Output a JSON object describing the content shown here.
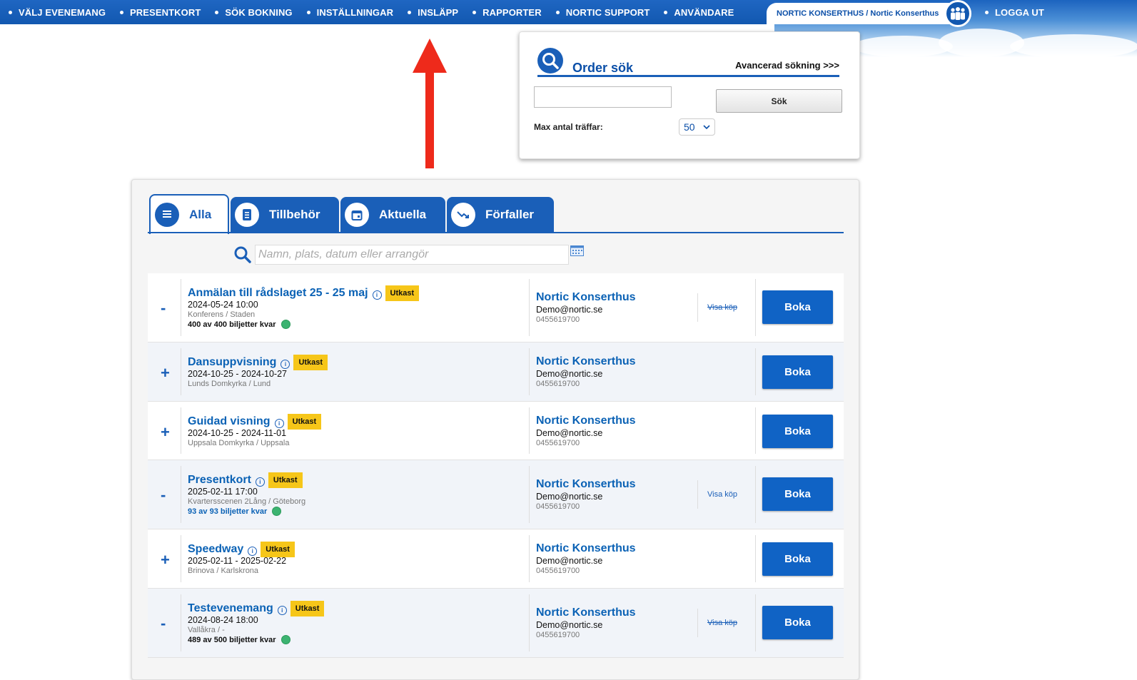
{
  "nav": {
    "items": [
      "VÄLJ EVENEMANG",
      "PRESENTKORT",
      "SÖK BOKNING",
      "INSTÄLLNINGAR",
      "INSLÄPP",
      "RAPPORTER",
      "NORTIC SUPPORT",
      "ANVÄNDARE"
    ],
    "org": "NORTIC KONSERTHUS / Nortic Konserthus",
    "logout": "LOGGA UT",
    "org_icon": "users-icon"
  },
  "order_search": {
    "title": "Order sök",
    "advanced": "Avancerad sökning >>>",
    "input_value": "",
    "button": "Sök",
    "max_label": "Max antal träffar:",
    "max_value": "50"
  },
  "tabs": [
    {
      "label": "Alla",
      "icon": "list-icon",
      "active": true
    },
    {
      "label": "Tillbehör",
      "icon": "document-icon",
      "active": false
    },
    {
      "label": "Aktuella",
      "icon": "calendar-icon",
      "active": false
    },
    {
      "label": "Förfaller",
      "icon": "trend-down-icon",
      "active": false
    }
  ],
  "search": {
    "placeholder": "Namn, plats, datum eller arrangör"
  },
  "events": [
    {
      "toggle": "-",
      "title": "Anmälan till rådslaget 25 - 25 maj",
      "badge": "Utkast",
      "date": "2024-05-24 10:00",
      "place": "Konferens / Staden",
      "left": "400 av 400 biljetter kvar",
      "org": "Nortic Konserthus",
      "email": "Demo@nortic.se",
      "phone": "0455619700",
      "visa": "Visa köp",
      "boka": "Boka"
    },
    {
      "toggle": "+",
      "title": "Dansuppvisning",
      "badge": "Utkast",
      "date": "2024-10-25 - 2024-10-27",
      "place": "Lunds Domkyrka / Lund",
      "left": "",
      "org": "Nortic Konserthus",
      "email": "Demo@nortic.se",
      "phone": "0455619700",
      "visa": "",
      "boka": "Boka"
    },
    {
      "toggle": "+",
      "title": "Guidad visning",
      "badge": "Utkast",
      "date": "2024-10-25 - 2024-11-01",
      "place": "Uppsala Domkyrka / Uppsala",
      "left": "",
      "org": "Nortic Konserthus",
      "email": "Demo@nortic.se",
      "phone": "0455619700",
      "visa": "",
      "boka": "Boka"
    },
    {
      "toggle": "-",
      "title": "Presentkort",
      "badge": "Utkast",
      "date": "2025-02-11 17:00",
      "place": "Kvartersscenen 2Lång / Göteborg",
      "left": "93 av 93 biljetter kvar",
      "org": "Nortic Konserthus",
      "email": "Demo@nortic.se",
      "phone": "0455619700",
      "visa": "Visa köp",
      "boka": "Boka"
    },
    {
      "toggle": "+",
      "title": "Speedway",
      "badge": "Utkast",
      "date": "2025-02-11 - 2025-02-22",
      "place": "Brinova / Karlskrona",
      "left": "",
      "org": "Nortic Konserthus",
      "email": "Demo@nortic.se",
      "phone": "0455619700",
      "visa": "",
      "boka": "Boka"
    },
    {
      "toggle": "-",
      "title": "Testevenemang",
      "badge": "Utkast",
      "date": "2024-08-24 18:00",
      "place": "Vallåkra / -",
      "left": "489 av 500 biljetter kvar",
      "org": "Nortic Konserthus",
      "email": "Demo@nortic.se",
      "phone": "0455619700",
      "visa": "Visa köp",
      "boka": "Boka"
    }
  ],
  "colors": {
    "brand": "#1a5fb8",
    "badge": "#f6c619",
    "annotation_arrow": "#ee2a1b"
  }
}
